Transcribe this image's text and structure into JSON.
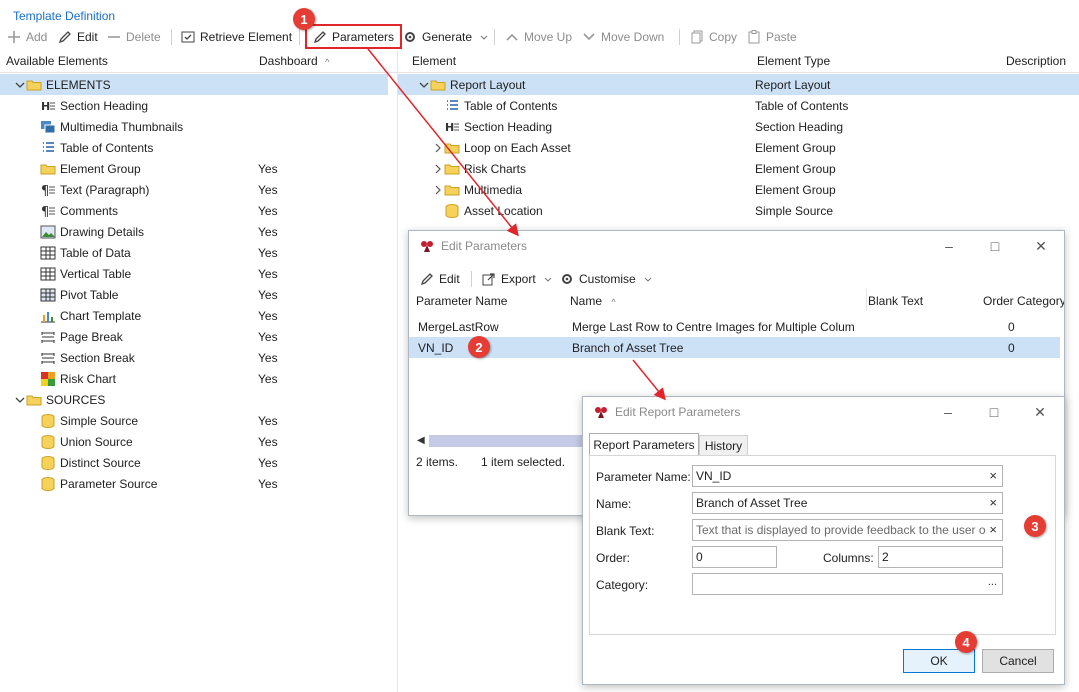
{
  "window": {
    "title": "Template Definition"
  },
  "toolbar": {
    "add": "Add",
    "edit": "Edit",
    "delete": "Delete",
    "retrieve": "Retrieve Element",
    "parameters": "Parameters",
    "generate": "Generate",
    "move_up": "Move Up",
    "move_down": "Move Down",
    "copy": "Copy",
    "paste": "Paste"
  },
  "left_panel": {
    "headers": {
      "available": "Available Elements",
      "dashboard": "Dashboard"
    },
    "groups": [
      {
        "label": "ELEMENTS"
      },
      {
        "label": "SOURCES"
      }
    ],
    "elements": [
      {
        "label": "Section Heading",
        "icon": "section-heading-icon",
        "dashboard": ""
      },
      {
        "label": "Multimedia Thumbnails",
        "icon": "multimedia-thumbnails-icon",
        "dashboard": ""
      },
      {
        "label": "Table of Contents",
        "icon": "table-of-contents-icon",
        "dashboard": ""
      },
      {
        "label": "Element Group",
        "icon": "folder-icon",
        "dashboard": "Yes"
      },
      {
        "label": "Text (Paragraph)",
        "icon": "paragraph-icon",
        "dashboard": "Yes"
      },
      {
        "label": "Comments",
        "icon": "comments-icon",
        "dashboard": "Yes"
      },
      {
        "label": "Drawing Details",
        "icon": "drawing-icon",
        "dashboard": "Yes"
      },
      {
        "label": "Table of Data",
        "icon": "table-icon",
        "dashboard": "Yes"
      },
      {
        "label": "Vertical Table",
        "icon": "vertical-table-icon",
        "dashboard": "Yes"
      },
      {
        "label": "Pivot Table",
        "icon": "pivot-table-icon",
        "dashboard": "Yes"
      },
      {
        "label": "Chart Template",
        "icon": "chart-icon",
        "dashboard": "Yes"
      },
      {
        "label": "Page Break",
        "icon": "page-break-icon",
        "dashboard": "Yes"
      },
      {
        "label": "Section Break",
        "icon": "section-break-icon",
        "dashboard": "Yes"
      },
      {
        "label": "Risk Chart",
        "icon": "risk-chart-icon",
        "dashboard": "Yes"
      }
    ],
    "sources": [
      {
        "label": "Simple Source",
        "icon": "database-icon",
        "dashboard": "Yes"
      },
      {
        "label": "Union Source",
        "icon": "database-icon",
        "dashboard": "Yes"
      },
      {
        "label": "Distinct Source",
        "icon": "database-icon",
        "dashboard": "Yes"
      },
      {
        "label": "Parameter Source",
        "icon": "database-icon",
        "dashboard": "Yes"
      }
    ]
  },
  "right_panel": {
    "headers": {
      "element": "Element",
      "type": "Element Type",
      "description": "Description"
    },
    "rows": [
      {
        "label": "Report Layout",
        "type": "Report Layout"
      },
      {
        "label": "Table of Contents",
        "type": "Table of Contents"
      },
      {
        "label": "Section Heading",
        "type": "Section Heading"
      },
      {
        "label": "Loop on Each Asset",
        "type": "Element Group"
      },
      {
        "label": "Risk Charts",
        "type": "Element Group"
      },
      {
        "label": "Multimedia",
        "type": "Element Group"
      },
      {
        "label": "Asset Location",
        "type": "Simple Source"
      }
    ]
  },
  "edit_parameters": {
    "title": "Edit Parameters",
    "toolbar": {
      "edit": "Edit",
      "export": "Export",
      "customise": "Customise"
    },
    "columns": {
      "param_name": "Parameter Name",
      "name": "Name",
      "blank": "Blank Text",
      "order": "Order",
      "category": "Category"
    },
    "rows": [
      {
        "param": "MergeLastRow",
        "name": "Merge Last Row to Centre Images for Multiple Colum",
        "order": "0"
      },
      {
        "param": "VN_ID",
        "name": "Branch of Asset Tree",
        "order": "0"
      }
    ],
    "status": {
      "count": "2 items.",
      "selected": "1 item selected."
    }
  },
  "edit_report_parameters": {
    "title": "Edit Report Parameters",
    "tabs": {
      "report": "Report Parameters",
      "history": "History"
    },
    "labels": {
      "param_name": "Parameter Name:",
      "name": "Name:",
      "blank": "Blank Text:",
      "order": "Order:",
      "columns": "Columns:",
      "category": "Category:"
    },
    "values": {
      "param_name": "VN_ID",
      "name": "Branch of Asset Tree",
      "blank": "Text that is displayed to provide feedback to the user or",
      "order": "0",
      "columns": "2",
      "category": ""
    },
    "buttons": {
      "ok": "OK",
      "cancel": "Cancel"
    }
  },
  "badges": [
    "1",
    "2",
    "3",
    "4"
  ],
  "colors": {
    "accent": "#1a6fc9",
    "selection": "#cce1f6",
    "highlight": "#e0262a",
    "badge": "#e53c34"
  }
}
